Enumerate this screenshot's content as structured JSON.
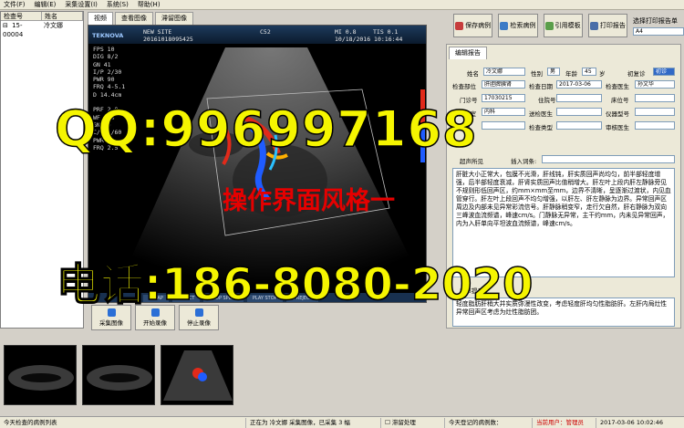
{
  "menu": [
    "文件(F)",
    "编辑(E)",
    "采集设置(I)",
    "系统(S)",
    "帮助(H)"
  ],
  "patient_list": {
    "headers": [
      "检查号",
      "姓名"
    ],
    "rows": [
      {
        "id": "15-00004",
        "name": "冷文娜"
      }
    ]
  },
  "view_tabs": [
    "视频",
    "查看图像",
    "滞留图像"
  ],
  "viewer": {
    "site": "NEW SITE",
    "id": "20161018095425",
    "probe": "C52",
    "mi": "MI 0.8",
    "tis": "TIS 0.1",
    "datetime": "10/18/2016 10:16:44",
    "brand": "TEKNOVA",
    "params": [
      "FPS  10",
      "DIG  8/2",
      "GN   41",
      "I/P  2/30",
      "PWR  90",
      "FRQ  4-5.1",
      "D    14.4cm",
      "",
      "PRF  2.0",
      "WF   150",
      "GN   30",
      "C/P  3/60",
      "PWR  70",
      "FRQ  2.5"
    ],
    "bottom_buttons": [
      "C MAP",
      "EFFECT",
      "LOOP SPEED",
      "PLAY STOP",
      "B REJECT"
    ]
  },
  "capture_buttons": [
    {
      "label": "采集图像",
      "color": "#2b6fd6"
    },
    {
      "label": "开始录像",
      "color": "#2b6fd6"
    },
    {
      "label": "停止录像",
      "color": "#2b6fd6"
    }
  ],
  "toolbar": {
    "buttons": [
      {
        "label": "保存病例",
        "color": "#c63c3c"
      },
      {
        "label": "检索病例",
        "color": "#3c7bc6"
      },
      {
        "label": "引用模板",
        "color": "#5a9e4a"
      },
      {
        "label": "打印报告",
        "color": "#4a6ea8"
      }
    ],
    "print_label": "选择打印报告单",
    "paper": "A4"
  },
  "report_tab": "编辑报告",
  "form": {
    "name_label": "姓名",
    "name_value": "冷文娜",
    "sex_label": "性别",
    "sex_value": "男",
    "age_label": "年龄",
    "age_value": "45",
    "age_unit": "岁",
    "visit_label": "初复诊",
    "visit_value": "初诊",
    "part_label": "检查部位",
    "part_value": "肝胆脾胰肾",
    "date_label": "检查日期",
    "date_value": "2017-03-06",
    "doctor_label": "检查医生",
    "doctor_value": "孙文华",
    "exam_no_label": "门诊号",
    "exam_no_value": "17030215",
    "bed_label": "住院号",
    "bed_no_label": "床位号",
    "dept_label": "送检科室",
    "dept_value": "内科",
    "send_doctor_label": "送检医生",
    "device_label": "仪器型号",
    "fee_label": "检查费",
    "type_label": "检查类型",
    "reviewer_label": "审核医生"
  },
  "findings_label": "超声所见",
  "insert_label": "插入词条:",
  "findings_text": "肝脏大小正常大，包膜不光滑，肝线钝，肝实质回声尚均匀，前半部轻度增强，后半部轻度衰减，肝肾实质回声比值稍增大。肝左叶上段内肝左静脉旁见不规则形低回声区，约mm×mm至mm，边界不清晰，呈逐渐过渡状，内见血管穿行。肝左叶上段回声不均匀增强，以肝左、肝左静脉为边界。异常回声区周边及内部未见异常彩流信号。肝静脉稍变窄，走行欠自然，肝右静脉为双向三峰波血流频谱，峰速cm/s。门静脉无异常，主干约mm，内未见异常回声，内为入肝单向平坦波血流频谱，峰速cm/s。",
  "impression_label": "超声提示",
  "impression_text": "轻度脂肪肝稍大并实质弥漫性改变，考虑轻度肝均匀性脂肪肝。左肝内局灶性异常回声区考虑为灶性脂肪团。",
  "status": {
    "today_cases": "今天检查的病例列表",
    "capturing": "正在为 冷文娜 采集图像，已采集 3 幅",
    "retain": "滞留处理",
    "registered": "今天登记的病例数：",
    "user_label": "当前用户：",
    "user": "管理员",
    "time": "2017-03-06 10:02:46"
  },
  "watermarks": {
    "qq": "QQ:996997168",
    "style": "操作界面风格一",
    "phone": "电话:186-8080-2020"
  }
}
